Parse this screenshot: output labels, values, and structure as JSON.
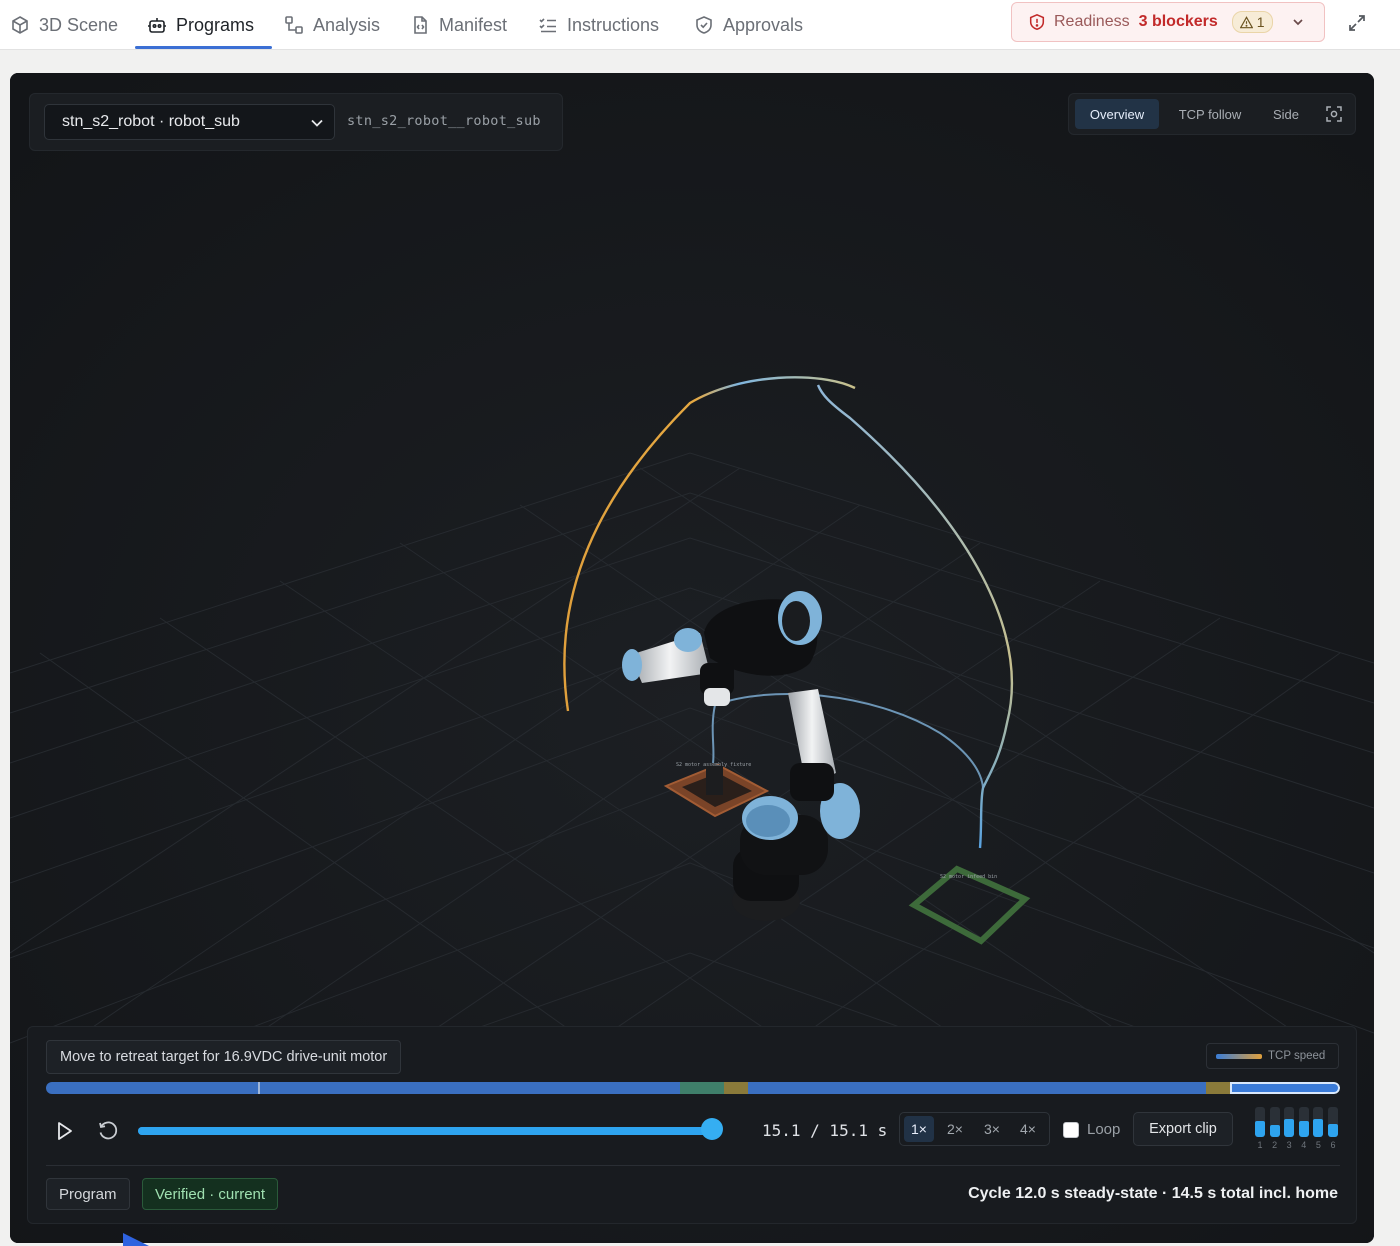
{
  "tabs": [
    {
      "label": "3D Scene",
      "icon": "cube-icon"
    },
    {
      "label": "Programs",
      "icon": "robot-icon",
      "active": true
    },
    {
      "label": "Analysis",
      "icon": "nodes-icon"
    },
    {
      "label": "Manifest",
      "icon": "file-code-icon"
    },
    {
      "label": "Instructions",
      "icon": "list-check-icon"
    },
    {
      "label": "Approvals",
      "icon": "shield-check-icon"
    }
  ],
  "readiness": {
    "label": "Readiness",
    "blockers": "3 blockers",
    "warnings": "1",
    "accent": "#c22a2a"
  },
  "program": {
    "selected": "stn_s2_robot · robot_sub",
    "id": "stn_s2_robot__robot_sub"
  },
  "views": [
    {
      "label": "Overview",
      "active": true
    },
    {
      "label": "TCP follow"
    },
    {
      "label": "Side"
    }
  ],
  "scene": {
    "fixture_label": "S2 motor assembly fixture",
    "bin_label": "S2 motor infeed bin"
  },
  "playback": {
    "step_label": "Move to retreat target for 16.9VDC drive-unit motor",
    "legend": "TCP speed",
    "time": "15.1 / 15.1 s",
    "progress": 1.0,
    "speeds": [
      "1×",
      "2×",
      "3×",
      "4×"
    ],
    "active_speed": "1×",
    "loop_label": "Loop",
    "loop_checked": false,
    "export_label": "Export clip",
    "joints": [
      {
        "num": "1",
        "level": 0.55
      },
      {
        "num": "2",
        "level": 0.4
      },
      {
        "num": "3",
        "level": 0.6
      },
      {
        "num": "4",
        "level": 0.55
      },
      {
        "num": "5",
        "level": 0.6
      },
      {
        "num": "6",
        "level": 0.45
      }
    ]
  },
  "footer": {
    "program_chip": "Program",
    "status_chip": "Verified · current",
    "cycle": "Cycle 12.0 s steady-state · 14.5 s total incl. home"
  },
  "colors": {
    "accent": "#3b6fd4",
    "timeline_blue": "#3a6fc0",
    "progress": "#2ea4ef",
    "verified": "#9fe0b0"
  }
}
